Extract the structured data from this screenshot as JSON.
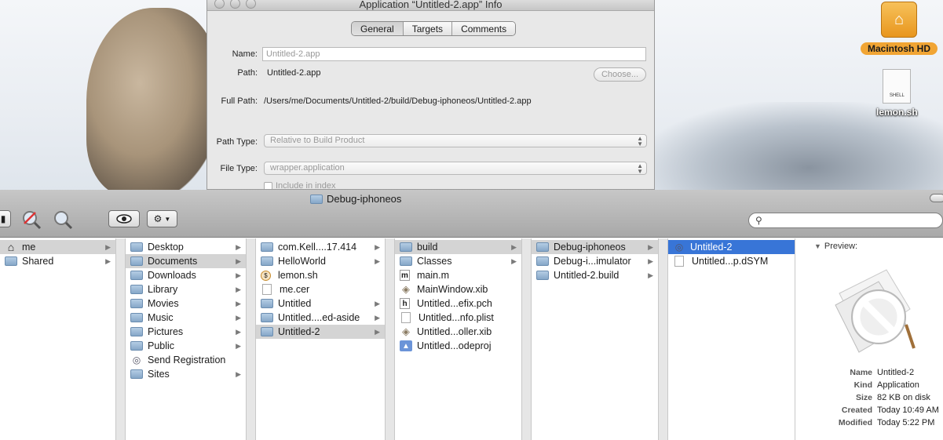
{
  "desktop": {
    "icons": [
      {
        "name": "hd",
        "label": "Macintosh HD"
      },
      {
        "name": "script",
        "label": "lemon.sh",
        "badge": "SHELL"
      }
    ]
  },
  "info_window": {
    "title": "Application “Untitled-2.app” Info",
    "tabs": [
      "General",
      "Targets",
      "Comments"
    ],
    "active_tab": "General",
    "name_label": "Name:",
    "name_placeholder": "Untitled-2.app",
    "path_label": "Path:",
    "path_value": "Untitled-2.app",
    "choose_label": "Choose...",
    "full_path_label": "Full Path:",
    "full_path_value": "/Users/me/Documents/Untitled-2/build/Debug-iphoneos/Untitled-2.app",
    "path_type_label": "Path Type:",
    "path_type_value": "Relative to Build Product",
    "file_type_label": "File Type:",
    "file_type_value": "wrapper.application",
    "include_label": "Include in index"
  },
  "finder": {
    "title": "Debug-iphoneos",
    "search_placeholder": "",
    "columns": [
      {
        "items": [
          {
            "label": "me",
            "icon": "home",
            "chevron": true,
            "sel": "gray"
          },
          {
            "label": "Shared",
            "icon": "folder",
            "chevron": true
          }
        ]
      },
      {
        "items": [
          {
            "label": "Desktop",
            "icon": "folder",
            "chevron": true
          },
          {
            "label": "Documents",
            "icon": "folder",
            "chevron": true,
            "sel": "gray"
          },
          {
            "label": "Downloads",
            "icon": "folder",
            "chevron": true
          },
          {
            "label": "Library",
            "icon": "folder",
            "chevron": true
          },
          {
            "label": "Movies",
            "icon": "folder",
            "chevron": true
          },
          {
            "label": "Music",
            "icon": "folder",
            "chevron": true
          },
          {
            "label": "Pictures",
            "icon": "folder",
            "chevron": true
          },
          {
            "label": "Public",
            "icon": "folder",
            "chevron": true
          },
          {
            "label": "Send Registration",
            "icon": "app",
            "chevron": false
          },
          {
            "label": "Sites",
            "icon": "folder",
            "chevron": true
          }
        ]
      },
      {
        "items": [
          {
            "label": "com.Kell....17.414",
            "icon": "folder",
            "chevron": true
          },
          {
            "label": "HelloWorld",
            "icon": "folder",
            "chevron": true
          },
          {
            "label": "lemon.sh",
            "icon": "sh",
            "chevron": false
          },
          {
            "label": "me.cer",
            "icon": "doc",
            "chevron": false
          },
          {
            "label": "Untitled",
            "icon": "folder",
            "chevron": true
          },
          {
            "label": "Untitled....ed-aside",
            "icon": "folder",
            "chevron": true
          },
          {
            "label": "Untitled-2",
            "icon": "folder",
            "chevron": true,
            "sel": "gray"
          }
        ]
      },
      {
        "items": [
          {
            "label": "build",
            "icon": "folder",
            "chevron": true,
            "sel": "gray"
          },
          {
            "label": "Classes",
            "icon": "folder",
            "chevron": true
          },
          {
            "label": "main.m",
            "icon": "m",
            "chevron": false
          },
          {
            "label": "MainWindow.xib",
            "icon": "xib",
            "chevron": false
          },
          {
            "label": "Untitled...efix.pch",
            "icon": "h",
            "chevron": false
          },
          {
            "label": "Untitled...nfo.plist",
            "icon": "doc",
            "chevron": false
          },
          {
            "label": "Untitled...oller.xib",
            "icon": "xib",
            "chevron": false
          },
          {
            "label": "Untitled...odeproj",
            "icon": "proj",
            "chevron": false
          }
        ]
      },
      {
        "items": [
          {
            "label": "Debug-iphoneos",
            "icon": "folder",
            "chevron": true,
            "sel": "gray"
          },
          {
            "label": "Debug-i...imulator",
            "icon": "folder",
            "chevron": true
          },
          {
            "label": "Untitled-2.build",
            "icon": "folder",
            "chevron": true
          }
        ]
      },
      {
        "items": [
          {
            "label": "Untitled-2",
            "icon": "app",
            "chevron": false,
            "sel": "blue"
          },
          {
            "label": "Untitled...p.dSYM",
            "icon": "doc",
            "chevron": false
          }
        ]
      }
    ],
    "preview": {
      "heading": "Preview:",
      "meta": [
        {
          "k": "Name",
          "v": "Untitled-2"
        },
        {
          "k": "Kind",
          "v": "Application"
        },
        {
          "k": "Size",
          "v": "82 KB on disk"
        },
        {
          "k": "Created",
          "v": "Today 10:49 AM"
        },
        {
          "k": "Modified",
          "v": "Today 5:22 PM"
        }
      ]
    }
  }
}
